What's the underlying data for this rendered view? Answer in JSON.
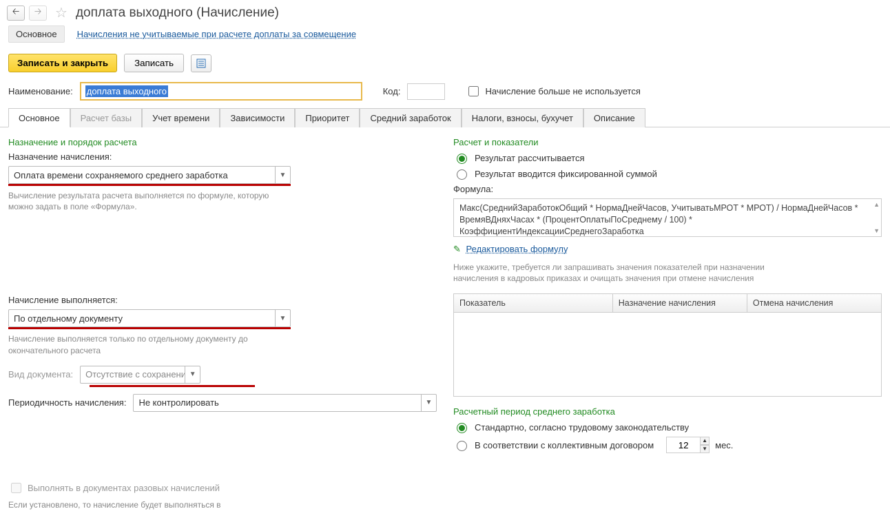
{
  "title": "доплата выходного (Начисление)",
  "links": {
    "main": "Основное",
    "secondary": "Начисления не учитываемые при расчете доплаты за совмещение"
  },
  "toolbar": {
    "save_close": "Записать и закрыть",
    "save": "Записать"
  },
  "header": {
    "name_label": "Наименование:",
    "name_value": "доплата выходного",
    "code_label": "Код:",
    "code_value": "",
    "discontinued_label": "Начисление больше не используется"
  },
  "tabs": [
    "Основное",
    "Расчет базы",
    "Учет времени",
    "Зависимости",
    "Приоритет",
    "Средний заработок",
    "Налоги, взносы, бухучет",
    "Описание"
  ],
  "left": {
    "section1_title": "Назначение и порядок расчета",
    "purpose_label": "Назначение начисления:",
    "purpose_value": "Оплата времени сохраняемого среднего заработка",
    "purpose_note": "Вычисление результата расчета выполняется по формуле, которую можно задать в поле «Формула».",
    "performed_label": "Начисление выполняется:",
    "performed_value": "По отдельному документу",
    "performed_note": "Начисление выполняется только по отдельному документу до окончательного расчета",
    "doctype_label": "Вид документа:",
    "doctype_value": "Отсутствие с сохранением",
    "period_label": "Периодичность начисления:",
    "period_value": "Не контролировать",
    "onetime_label": "Выполнять в документах разовых начислений",
    "onetime_note": "Если установлено, то начисление будет выполняться в"
  },
  "right": {
    "section2_title": "Расчет и показатели",
    "radio_calc": "Результат рассчитывается",
    "radio_fixed": "Результат вводится фиксированной суммой",
    "formula_label": "Формула:",
    "formula_text": "Макс(СреднийЗаработокОбщий * НормаДнейЧасов, УчитыватьМРОТ * МРОТ) / НормаДнейЧасов * ВремяВДняхЧасах * (ПроцентОплатыПоСреднему / 100) * КоэффициентИндексацииСреднегоЗаработка",
    "edit_formula": "Редактировать формулу",
    "below_note": "Ниже укажите, требуется ли запрашивать значения показателей при назначении начисления в кадровых приказах и очищать значения при отмене начисления",
    "table_headers": {
      "indicator": "Показатель",
      "assign": "Назначение начисления",
      "cancel": "Отмена начисления"
    },
    "section3_title": "Расчетный период среднего заработка",
    "radio_std": "Стандартно, согласно трудовому законодательству",
    "radio_coll": "В соответствии с коллективным договором",
    "months_value": "12",
    "months_suffix": "мес."
  }
}
